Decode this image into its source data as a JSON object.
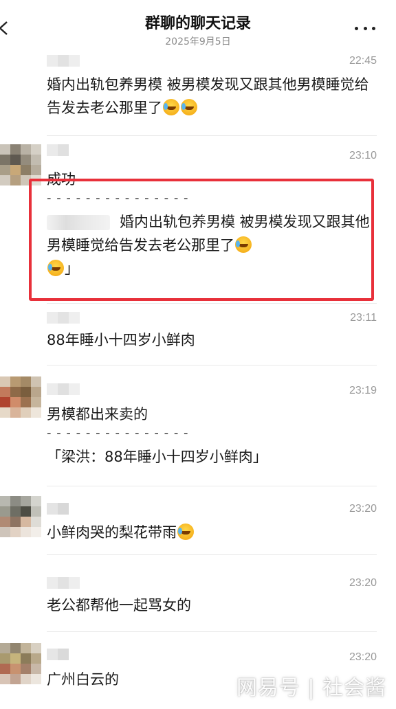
{
  "header": {
    "title": "群聊的聊天记录",
    "date": "2025年9月5日",
    "back_icon": "chevron-left-icon",
    "more_icon": "more-dots-icon"
  },
  "messages": [
    {
      "time": "22:45",
      "text": "婚内出轨包养男模 被男模发现又跟其他男模睡觉给告发去老公那里了",
      "emoji_count": 2
    },
    {
      "time": "23:10",
      "text": "成功",
      "quote_separator": "- - - - - - - - - - - - - - -",
      "quote_text": "婚内出轨包养男模 被男模发现又跟其他男模睡觉给告发去老公那里了",
      "quote_end": "」"
    },
    {
      "time": "23:11",
      "text": "88年睡小十四岁小鲜肉"
    },
    {
      "time": "23:19",
      "text": "男模都出来卖的",
      "quote_separator": "- - - - - - - - - - - - - - -",
      "quote_text": "「梁洪：88年睡小十四岁小鲜肉」"
    },
    {
      "time": "23:20",
      "text": "小鲜肉哭的梨花带雨"
    },
    {
      "time": "23:20",
      "text": "老公都帮他一起骂女的"
    },
    {
      "time": "23:20",
      "text": "广州白云的"
    }
  ],
  "watermark": "网易号 | 社会酱",
  "colors": {
    "highlight_border": "#e8303a",
    "time_text": "#9a9a9a"
  }
}
